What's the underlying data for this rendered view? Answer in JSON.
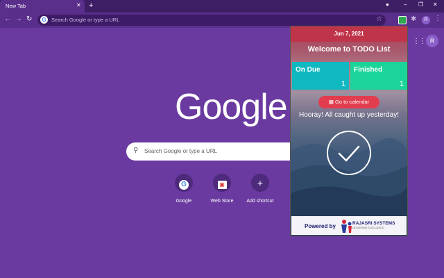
{
  "browser": {
    "tab_title": "New Tab",
    "tab_close": "✕",
    "new_tab": "+",
    "omnibox_placeholder": "Search Google or type a URL",
    "omnibox_icon": "G",
    "profile_initial": "R",
    "nav": {
      "back": "←",
      "forward": "→",
      "reload": "↻"
    },
    "controls": {
      "minimize": "–",
      "restore": "❐",
      "close": "✕",
      "star": "☆",
      "puzzle": "✱",
      "menu": "⋮",
      "apps": "⋮⋮⋮"
    }
  },
  "ntp": {
    "logo": "Google",
    "search_placeholder": "Search Google or type a URL",
    "profile_initial": "R",
    "shortcuts": [
      {
        "label": "Google",
        "icon": "G"
      },
      {
        "label": "Web Store",
        "icon": "▣"
      },
      {
        "label": "Add shortcut",
        "icon": "+"
      }
    ]
  },
  "popup": {
    "date": "Jun 7, 2021",
    "title": "Welcome to TODO List",
    "cards": [
      {
        "label": "On Due",
        "count": "1",
        "color": "#10b8c0"
      },
      {
        "label": "Finished",
        "count": "1",
        "color": "#1bd49a"
      }
    ],
    "calendar_button": "Go to calendar",
    "message": "Hooray! All caught up yesterday!",
    "footer": {
      "powered_by": "Powered by",
      "brand_name": "RAJASRI SYSTEMS",
      "brand_tag": "DELIVERING EXCELLENCE"
    }
  },
  "colors": {
    "page_bg": "#6a3aa0",
    "header_red": "#c0344a",
    "button_red": "#e23d4e"
  }
}
